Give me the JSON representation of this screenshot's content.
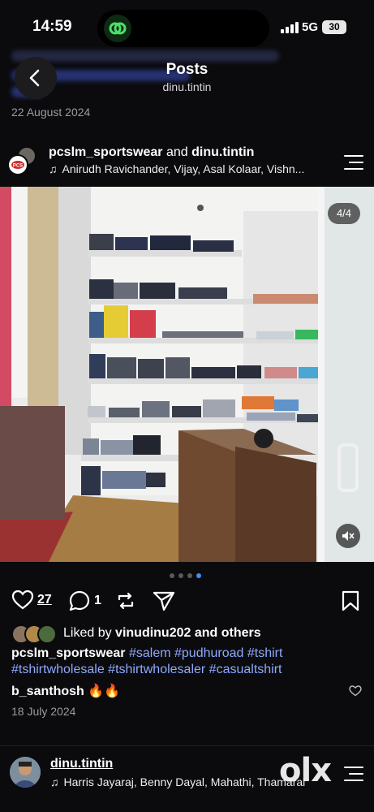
{
  "status_bar": {
    "time": "14:59",
    "network": "5G",
    "battery": "30"
  },
  "header": {
    "title": "Posts",
    "subtitle": "dinu.tintin"
  },
  "previous_post": {
    "date": "22 August 2024"
  },
  "post": {
    "users": {
      "primary": "pcslm_sportswear",
      "joiner": "and",
      "secondary": "dinu.tintin"
    },
    "music": "Anirudh Ravichander, Vijay, Asal Kolaar, Vishn...",
    "media_counter": "4/4",
    "carousel": {
      "total": 4,
      "active_index": 4
    },
    "likes_count": "27",
    "comments_count": "1",
    "liked_by": {
      "prefix": "Liked by",
      "user": "vinudinu202",
      "suffix": "and others"
    },
    "caption": {
      "user": "pcslm_sportswear",
      "tags_line1": "#salem #pudhuroad #tshirt",
      "tags_line2": "#tshirtwholesale #tshirtwholesaler #casualtshirt"
    },
    "comment": {
      "user": "b_santhosh",
      "text": "🔥🔥"
    },
    "date": "18 July 2024"
  },
  "next_post": {
    "user": "dinu.tintin",
    "music": "Harris Jayaraj, Benny Dayal, Mahathi, Thamarai"
  },
  "watermark": "olx",
  "icons": {
    "back": "chevron-left-icon",
    "menu": "menu-icon",
    "like": "heart-icon",
    "comment": "comment-icon",
    "repost": "repost-icon",
    "share": "send-icon",
    "save": "bookmark-icon",
    "mute": "speaker-muted-icon",
    "music": "music-note-icon"
  },
  "colors": {
    "background": "#0b0b0d",
    "hashtag": "#8ea9ff",
    "active_dot": "#3e8ef7"
  }
}
